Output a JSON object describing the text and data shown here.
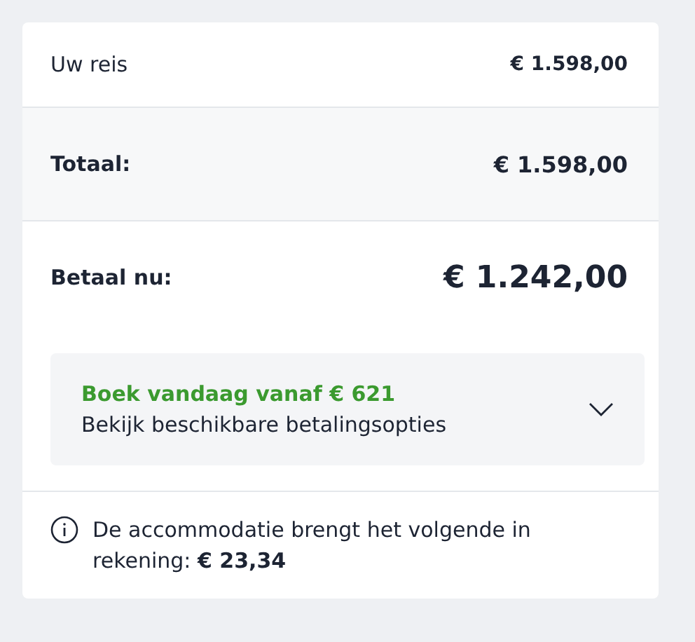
{
  "summary": [
    {
      "kind": "plain",
      "label": "Uw reis",
      "amount": "€ 1.598,00"
    },
    {
      "kind": "total",
      "label": "Totaal:",
      "amount": "€ 1.598,00"
    },
    {
      "kind": "due",
      "label": "Betaal nu:",
      "amount": "€ 1.242,00"
    }
  ],
  "payment_options": {
    "headline": "Boek vandaag vanaf € 621",
    "subtext": "Bekijk beschikbare betalingsopties",
    "expanded": false
  },
  "notice": "De accommodatie brengt het volgende in rekening: **€ 23,34**"
}
